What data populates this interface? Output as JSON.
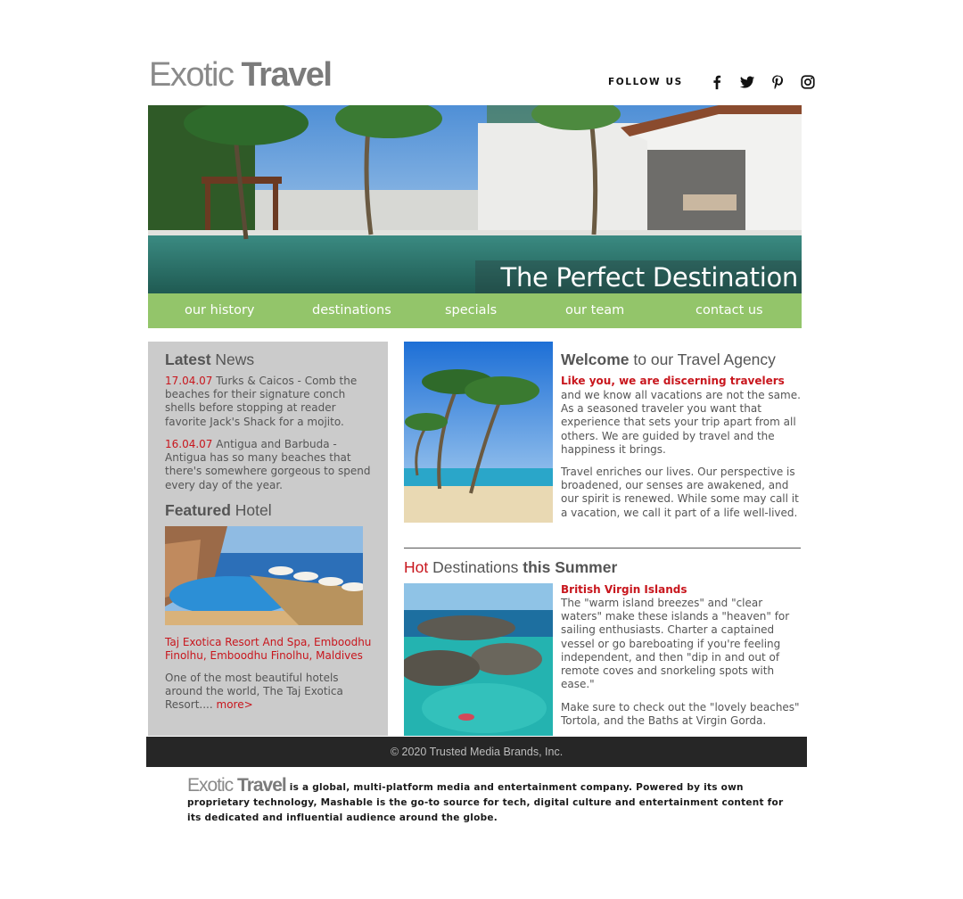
{
  "header": {
    "logo_word1": "Exotic",
    "logo_word2": "Travel",
    "follow_label": "FOLLOW US",
    "social_icons": [
      "facebook-icon",
      "twitter-icon",
      "pinterest-icon",
      "instagram-icon"
    ]
  },
  "hero": {
    "caption": "The Perfect Destination"
  },
  "nav": {
    "items": [
      "our history",
      "destinations",
      "specials",
      "our team",
      "contact us"
    ]
  },
  "sidebar": {
    "news_title_bold": "Latest",
    "news_title_rest": " News",
    "news": [
      {
        "date": "17.04.07",
        "text": " Turks & Caicos - Comb the beaches for their signature conch shells before stopping at reader favorite Jack's Shack for a mojito."
      },
      {
        "date": "16.04.07",
        "text": " Antigua and Barbuda - Antigua has so many beaches that there's somewhere gorgeous to spend every day of the year."
      }
    ],
    "featured_title_bold": "Featured",
    "featured_title_rest": " Hotel",
    "hotel_name": "Taj Exotica Resort And Spa, Emboodhu Finolhu, Emboodhu Finolhu, Maldives",
    "hotel_desc": "One of the most beautiful hotels around the world, The Taj Exotica Resort.... ",
    "more_label": "more>"
  },
  "welcome": {
    "title_bold": "Welcome",
    "title_rest": " to our Travel Agency",
    "subtitle": "Like you, we are discerning travelers",
    "para1": "and we know all vacations are not the same. As a seasoned traveler you want that experience that sets your trip apart from all others. We are guided by travel and the happiness it brings.",
    "para2": "Travel enriches our lives. Our perspective is broadened, our senses are awakened, and our spirit is renewed. While some may call it a vacation, we call it part of a life well-lived."
  },
  "hot": {
    "title_red": "Hot",
    "title_mid": " Destinations ",
    "title_bold": "this Summer",
    "subtitle": "British Virgin Islands",
    "para1": "The \"warm island breezes\" and \"clear waters\" make these islands a \"heaven\" for sailing enthusiasts. Charter a captained vessel or go bareboating if you're feeling independent, and then \"dip in and out of remote coves and snorkeling spots with ease.\"",
    "para2": "Make sure to check out the \"lovely beaches\" Tortola, and the Baths at Virgin Gorda."
  },
  "footer": {
    "copyright": "© 2020 Trusted Media Brands, Inc.",
    "about_logo_word1": "Exotic",
    "about_logo_word2": "Travel",
    "about_text": "is a global, multi-platform media and entertainment company. Powered by its own proprietary technology, Mashable is the go-to source for tech, digital culture and entertainment content for its dedicated and influential audience around the globe."
  },
  "colors": {
    "nav_green": "#93c56a",
    "accent_red": "#c8161d",
    "sidebar_gray": "#cbcbcb",
    "footer_dark": "#262626"
  }
}
